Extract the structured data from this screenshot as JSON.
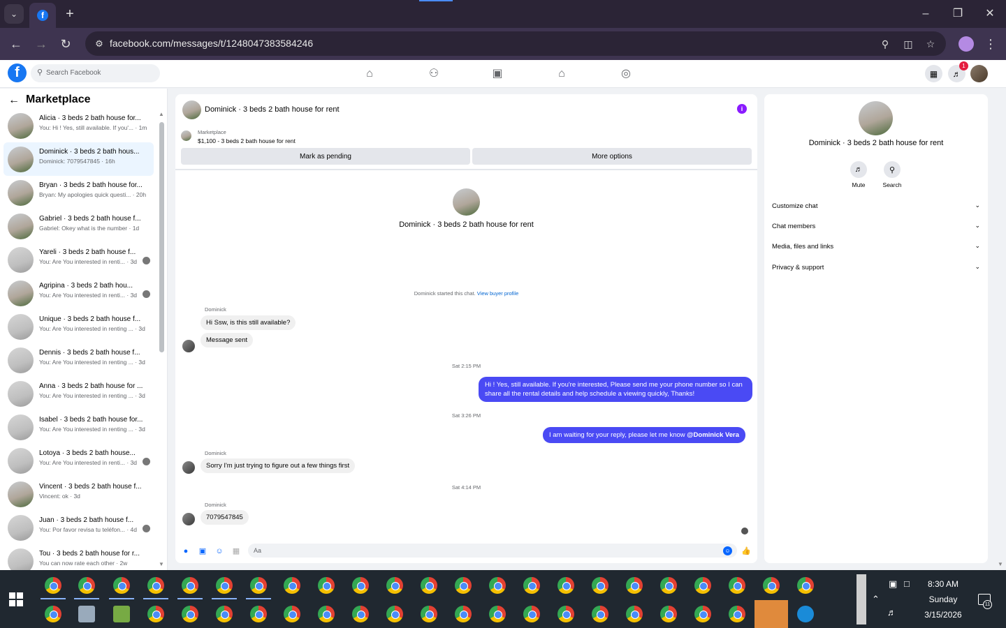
{
  "browser": {
    "url": "facebook.com/messages/t/1248047383584246"
  },
  "facebook": {
    "search_placeholder": "Search Facebook",
    "notification_count": "1"
  },
  "sidebar": {
    "title": "Marketplace",
    "conversations": [
      {
        "name": "Alicia · 3 beds 2 bath house for...",
        "preview": "You: Hi ! Yes, still available. If you'... · 1m",
        "avatar": "outdoor",
        "active": false
      },
      {
        "name": "Dominick · 3 beds 2 bath hous...",
        "preview": "Dominick: 7079547845 · 16h",
        "avatar": "outdoor",
        "active": true
      },
      {
        "name": "Bryan · 3 beds 2 bath house for...",
        "preview": "Bryan: My apologies quick questi... · 20h",
        "avatar": "outdoor",
        "active": false
      },
      {
        "name": "Gabriel · 3 beds 2 bath house f...",
        "preview": "Gabriel: Okey what is the number · 1d",
        "avatar": "outdoor",
        "active": false
      },
      {
        "name": "Yareli · 3 beds 2 bath house f...",
        "preview": "You: Are You interested in renti... · 3d",
        "avatar": "indoor",
        "active": false
      },
      {
        "name": "Agripina · 3 beds 2 bath hou...",
        "preview": "You: Are You interested in renti... · 3d",
        "avatar": "outdoor",
        "active": false
      },
      {
        "name": "Unique · 3 beds 2 bath house f...",
        "preview": "You: Are You interested in renting ... · 3d",
        "avatar": "indoor",
        "active": false
      },
      {
        "name": "Dennis · 3 beds 2 bath house f...",
        "preview": "You: Are You interested in renting ... · 3d",
        "avatar": "indoor",
        "active": false
      },
      {
        "name": "Anna · 3 beds 2 bath house for ...",
        "preview": "You: Are You interested in renting ... · 3d",
        "avatar": "indoor",
        "active": false
      },
      {
        "name": "Isabel · 3 beds 2 bath house for...",
        "preview": "You: Are You interested in renting ... · 3d",
        "avatar": "indoor",
        "active": false
      },
      {
        "name": "Lotoya · 3 beds 2 bath house...",
        "preview": "You: Are You interested in renti... · 3d",
        "avatar": "indoor",
        "active": false
      },
      {
        "name": "Vincent · 3 beds 2 bath house f...",
        "preview": "Vincent: ok · 3d",
        "avatar": "outdoor",
        "active": false
      },
      {
        "name": "Juan · 3 beds 2 bath house f...",
        "preview": "You: Por favor revisa tu teléfon... · 4d",
        "avatar": "indoor",
        "active": false
      },
      {
        "name": "Tou · 3 beds 2 bath house for r...",
        "preview": "You can now rate each other · 2w",
        "avatar": "indoor",
        "active": false
      }
    ]
  },
  "chat": {
    "title": "Dominick · 3 beds 2 bath house for rent",
    "marketplace_label": "Marketplace",
    "listing": "$1,100 - 3 beds 2 bath house for rent",
    "mark_pending": "Mark as pending",
    "more_options": "More options",
    "hero_title": "Dominick · 3 beds 2 bath house for rent",
    "started_text": "Dominick started this chat.",
    "view_profile": "View buyer profile",
    "sender_name": "Dominick",
    "msg1": "Hi Ssw, is this still available?",
    "msg2": "Message sent",
    "ts1": "Sat 2:15 PM",
    "out1": "Hi ! Yes, still available. If you're interested, Please send me your phone number so I can share all the rental details and help schedule a viewing quickly, Thanks!",
    "ts2": "Sat 3:26 PM",
    "out2_text": "I am waiting for your reply, please let me know ",
    "out2_mention": "@Dominick Vera",
    "msg3": "Sorry I'm just trying to figure out a few things first",
    "ts3": "Sat 4:14 PM",
    "msg4": "7079547845",
    "compose_placeholder": "Aa"
  },
  "info": {
    "title": "Dominick · 3 beds 2 bath house for rent",
    "mute": "Mute",
    "search": "Search",
    "rows": [
      "Customize chat",
      "Chat members",
      "Media, files and links",
      "Privacy & support"
    ]
  },
  "taskbar": {
    "time": "8:30 AM",
    "day": "Sunday",
    "date": "3/15/2026",
    "notifications": "11"
  }
}
